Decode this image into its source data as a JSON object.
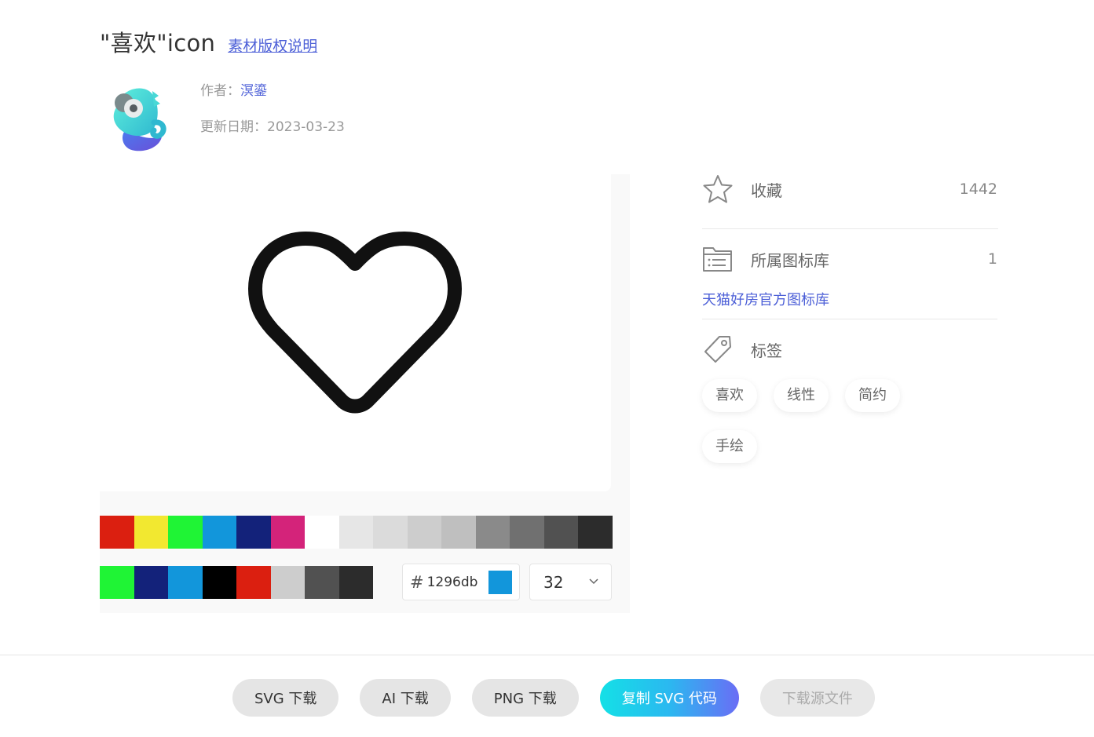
{
  "header": {
    "title": "\"喜欢\"icon",
    "copyright_link": "素材版权说明"
  },
  "meta": {
    "author_label": "作者：",
    "author_name": "溟鎏",
    "date_label": "更新日期：",
    "date_value": "2023-03-23"
  },
  "palette": {
    "row1": [
      "#db1f10",
      "#f2e830",
      "#1ff435",
      "#1296db",
      "#13227a",
      "#d4237a",
      "#ffffff",
      "#e6e6e6",
      "#dbdbdb",
      "#cdcdcd",
      "#bfbfbf",
      "#8a8a8a",
      "#707070",
      "#515151",
      "#2c2c2c"
    ],
    "row2": [
      "#1ff435",
      "#13227a",
      "#1296db",
      "#000000",
      "#db1f10",
      "#cdcdcd",
      "#515151",
      "#2c2c2c"
    ]
  },
  "color_picker": {
    "hash": "#",
    "hex_value": "1296db",
    "preview_color": "#1296db"
  },
  "size": {
    "value": "32"
  },
  "icon": {
    "stroke_color": "#111111"
  },
  "sidebar": {
    "favorite": {
      "label": "收藏",
      "count": "1442",
      "icon": "star-icon"
    },
    "library": {
      "label": "所属图标库",
      "count": "1",
      "icon": "folder-list-icon",
      "link": "天猫好房官方图标库"
    },
    "tags": {
      "label": "标签",
      "icon": "tag-icon",
      "items": [
        "喜欢",
        "线性",
        "简约",
        "手绘"
      ]
    }
  },
  "footer": {
    "buttons": [
      "SVG 下载",
      "AI 下载",
      "PNG 下载",
      "复制 SVG 代码",
      "下载源文件"
    ]
  }
}
